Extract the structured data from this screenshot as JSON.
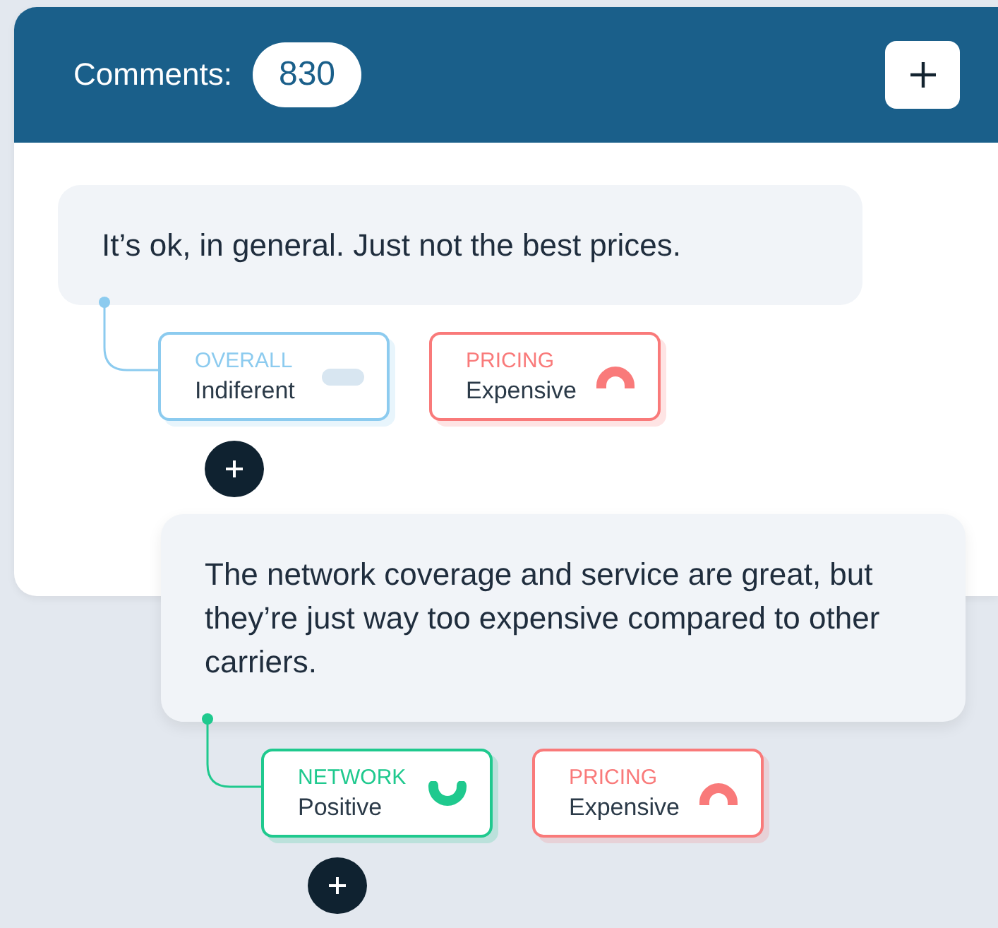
{
  "header": {
    "title": "Comments:",
    "count": "830"
  },
  "comments": [
    {
      "text": "It’s ok, in general. Just not the best prices.",
      "color": "#8ccbef",
      "tags": [
        {
          "label": "OVERALL",
          "value": "Indiferent",
          "kind": "neutral",
          "color": "#8ccbef"
        },
        {
          "label": "PRICING",
          "value": "Expensive",
          "kind": "negative",
          "color": "#f97a7a"
        }
      ]
    },
    {
      "text": "The network coverage and service are great, but they’re just way too expensive compared to other carriers.",
      "color": "#1fc98e",
      "tags": [
        {
          "label": "NETWORK",
          "value": "Positive",
          "kind": "positive",
          "color": "#1fc98e"
        },
        {
          "label": "PRICING",
          "value": "Expensive",
          "kind": "negative",
          "color": "#f97a7a"
        }
      ]
    }
  ]
}
